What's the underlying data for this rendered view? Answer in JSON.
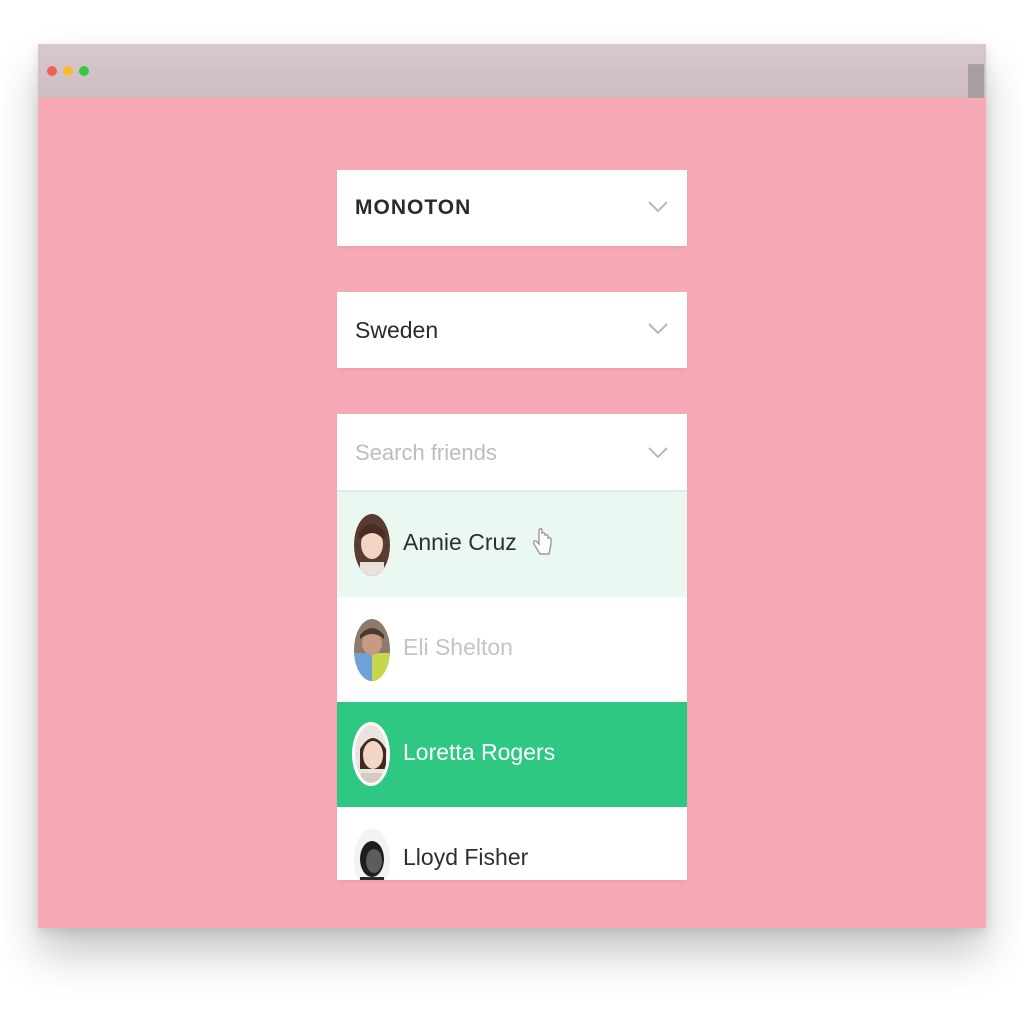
{
  "window": {
    "controls": [
      "close",
      "minimize",
      "maximize"
    ]
  },
  "font_select": {
    "value": "MONOTON",
    "icon": "chevron-down-icon"
  },
  "country_select": {
    "value": "Sweden",
    "icon": "chevron-down-icon"
  },
  "friends_select": {
    "placeholder": "Search friends",
    "icon": "chevron-down-icon",
    "options": [
      {
        "name": "Annie Cruz",
        "state": "hover"
      },
      {
        "name": "Eli Shelton",
        "state": "disabled"
      },
      {
        "name": "Loretta Rogers",
        "state": "selected"
      },
      {
        "name": "Lloyd Fisher",
        "state": "normal"
      }
    ]
  },
  "colors": {
    "background": "#f7aab5",
    "selected": "#2ec882",
    "hover": "#eaf8f1"
  }
}
